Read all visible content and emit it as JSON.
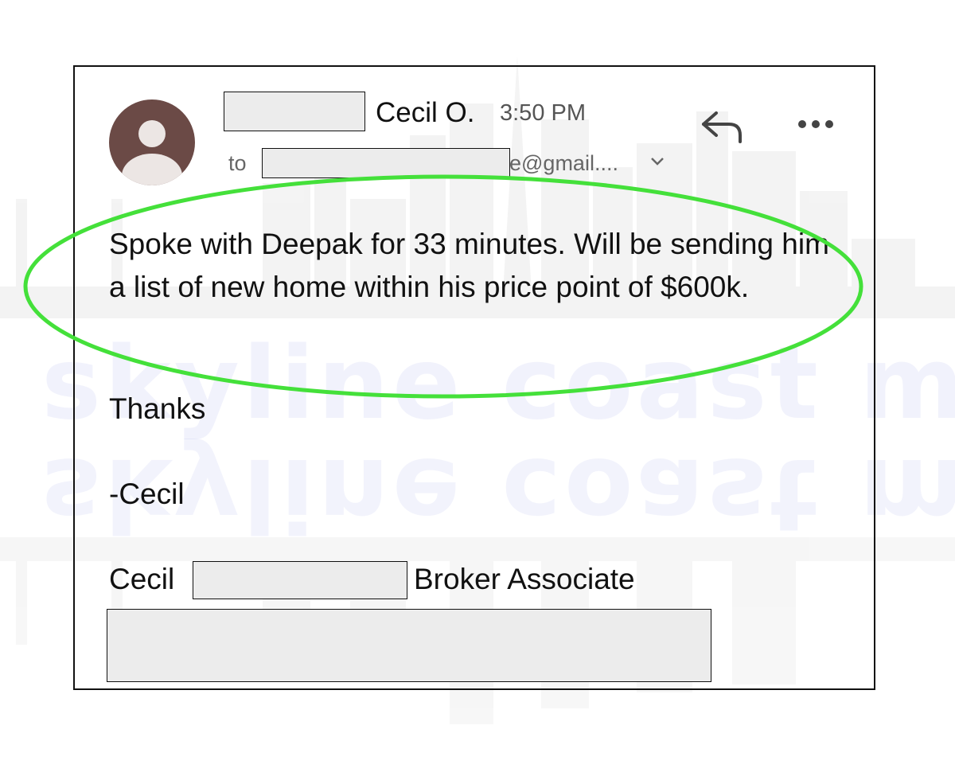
{
  "email": {
    "sender_name": "Cecil O.",
    "time": "3:50 PM",
    "to_label": "to",
    "to_address_visible": "e@gmail....",
    "body": "Spoke with Deepak for 33 minutes. Will be sending him a list of new home within his price point of $600k.",
    "closing": "Thanks",
    "sign_off": "-Cecil",
    "signature": {
      "first_name": "Cecil",
      "title": "Broker Associate"
    }
  },
  "watermark": {
    "text": "skyline coast media"
  },
  "icons": {
    "avatar": "person-avatar-icon",
    "reply": "reply-arrow-icon",
    "more": "more-options-icon",
    "expand": "chevron-down-icon"
  },
  "colors": {
    "highlight_ellipse": "#44e03a",
    "avatar_bg": "#6b4a46",
    "redaction_fill": "#ececec",
    "watermark": "#1d2fd0"
  }
}
